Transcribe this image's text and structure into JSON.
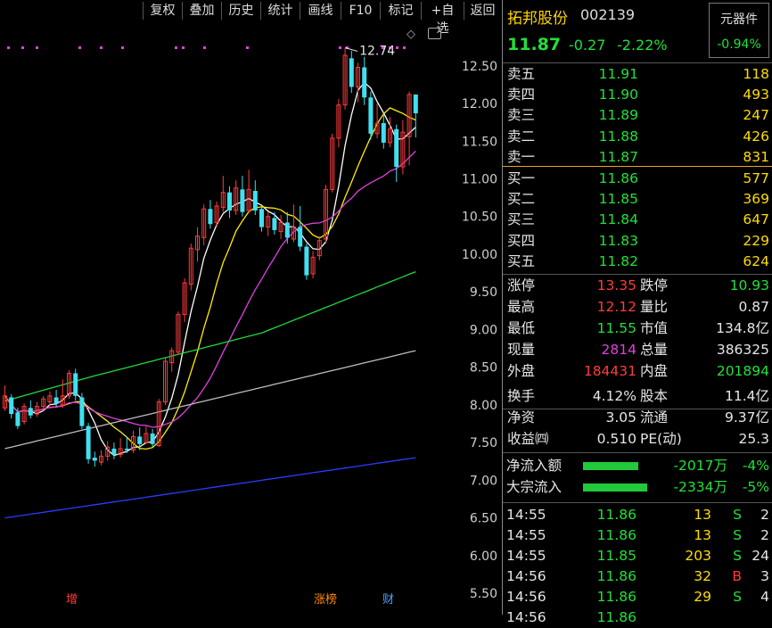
{
  "toolbar": {
    "items": [
      "复权",
      "叠加",
      "历史",
      "统计",
      "画线",
      "F10",
      "标记",
      "+自选",
      "返回"
    ]
  },
  "stock": {
    "name": "拓邦股份",
    "code": "002139",
    "sector": "元器件",
    "sector_change": "-0.94%",
    "price": "11.87",
    "change": "-0.27",
    "change_pct": "-2.22%"
  },
  "orderbook": {
    "asks": [
      {
        "label": "卖五",
        "price": "11.91",
        "vol": "118"
      },
      {
        "label": "卖四",
        "price": "11.90",
        "vol": "493"
      },
      {
        "label": "卖三",
        "price": "11.89",
        "vol": "247"
      },
      {
        "label": "卖二",
        "price": "11.88",
        "vol": "426"
      },
      {
        "label": "卖一",
        "price": "11.87",
        "vol": "831"
      }
    ],
    "bids": [
      {
        "label": "买一",
        "price": "11.86",
        "vol": "577"
      },
      {
        "label": "买二",
        "price": "11.85",
        "vol": "369"
      },
      {
        "label": "买三",
        "price": "11.84",
        "vol": "647"
      },
      {
        "label": "买四",
        "price": "11.83",
        "vol": "229"
      },
      {
        "label": "买五",
        "price": "11.82",
        "vol": "624"
      }
    ]
  },
  "stats": {
    "limit_up_label": "涨停",
    "limit_up": "13.35",
    "limit_down_label": "跌停",
    "limit_down": "10.93",
    "high_label": "最高",
    "high": "12.12",
    "vol_ratio_label": "量比",
    "vol_ratio": "0.87",
    "low_label": "最低",
    "low": "11.55",
    "mktcap_label": "市值",
    "mktcap": "134.8亿",
    "cur_vol_label": "现量",
    "cur_vol": "2814",
    "total_vol_label": "总量",
    "total_vol": "386325",
    "outer_label": "外盘",
    "outer": "184431",
    "inner_label": "内盘",
    "inner": "201894",
    "turnover_label": "换手",
    "turnover": "4.12%",
    "equity_label": "股本",
    "equity": "11.4亿",
    "nav_label": "净资",
    "nav": "3.05",
    "float_label": "流通",
    "float": "9.37亿",
    "eps_label": "收益㈣",
    "eps": "0.510",
    "pe_label": "PE(动)",
    "pe": "25.3"
  },
  "flows": [
    {
      "label": "净流入额",
      "value": "-2017万",
      "pct": "-4%",
      "bar": 0.62
    },
    {
      "label": "大宗流入",
      "value": "-2334万",
      "pct": "-5%",
      "bar": 0.72
    }
  ],
  "ticks": [
    {
      "time": "14:55",
      "price": "11.86",
      "vol": "13",
      "side": "S",
      "n": "2"
    },
    {
      "time": "14:55",
      "price": "11.86",
      "vol": "13",
      "side": "S",
      "n": "2"
    },
    {
      "time": "14:55",
      "price": "11.85",
      "vol": "203",
      "side": "S",
      "n": "24"
    },
    {
      "time": "14:56",
      "price": "11.86",
      "vol": "32",
      "side": "B",
      "n": "3"
    },
    {
      "time": "14:56",
      "price": "11.86",
      "vol": "29",
      "side": "S",
      "n": "4"
    },
    {
      "time": "14:56",
      "price": "11.86",
      "vol": "",
      "side": "",
      "n": ""
    }
  ],
  "chart_data": {
    "type": "candlestick",
    "y_ticks": [
      "12.50",
      "12.00",
      "11.50",
      "11.00",
      "10.50",
      "10.00",
      "9.50",
      "9.00",
      "8.50",
      "8.00",
      "7.50",
      "7.00",
      "6.50",
      "6.00",
      "5.50"
    ],
    "ylim": [
      5.3,
      12.9
    ],
    "high_annotation": "12.74",
    "markers": [
      "增",
      "涨榜",
      "财"
    ],
    "candles": [
      [
        7.96,
        8.12,
        8.26,
        7.92
      ],
      [
        8.1,
        7.88,
        8.14,
        7.82
      ],
      [
        7.9,
        7.72,
        7.96,
        7.68
      ],
      [
        7.78,
        7.98,
        8.02,
        7.74
      ],
      [
        7.96,
        7.86,
        8.06,
        7.82
      ],
      [
        7.88,
        7.98,
        8.04,
        7.84
      ],
      [
        7.98,
        8.08,
        8.12,
        7.92
      ],
      [
        8.04,
        8.12,
        8.18,
        7.98
      ],
      [
        8.1,
        8.02,
        8.2,
        7.98
      ],
      [
        8.0,
        8.12,
        8.34,
        7.96
      ],
      [
        8.12,
        8.42,
        8.46,
        8.08
      ],
      [
        8.42,
        8.12,
        8.48,
        8.06
      ],
      [
        8.1,
        7.72,
        8.16,
        7.68
      ],
      [
        7.72,
        7.28,
        7.76,
        7.22
      ],
      [
        7.3,
        7.26,
        7.38,
        7.18
      ],
      [
        7.24,
        7.32,
        7.4,
        7.2
      ],
      [
        7.32,
        7.44,
        7.52,
        7.26
      ],
      [
        7.42,
        7.34,
        7.5,
        7.28
      ],
      [
        7.34,
        7.42,
        7.56,
        7.3
      ],
      [
        7.42,
        7.4,
        7.58,
        7.36
      ],
      [
        7.4,
        7.58,
        7.66,
        7.36
      ],
      [
        7.58,
        7.48,
        7.7,
        7.4
      ],
      [
        7.5,
        7.62,
        7.72,
        7.48
      ],
      [
        7.62,
        7.48,
        7.68,
        7.44
      ],
      [
        7.46,
        8.04,
        8.08,
        7.44
      ],
      [
        8.04,
        8.58,
        8.62,
        8.0
      ],
      [
        8.56,
        8.72,
        8.76,
        8.44
      ],
      [
        8.7,
        9.2,
        9.24,
        8.66
      ],
      [
        9.2,
        9.62,
        9.68,
        9.1
      ],
      [
        9.6,
        10.08,
        10.14,
        9.52
      ],
      [
        10.06,
        10.24,
        10.36,
        9.9
      ],
      [
        10.22,
        10.6,
        10.66,
        10.12
      ],
      [
        10.6,
        10.4,
        10.72,
        10.34
      ],
      [
        10.42,
        10.64,
        10.7,
        10.36
      ],
      [
        10.62,
        10.82,
        11.04,
        10.56
      ],
      [
        10.82,
        10.58,
        10.9,
        10.48
      ],
      [
        10.58,
        10.88,
        10.98,
        10.52
      ],
      [
        10.86,
        10.56,
        11.04,
        10.5
      ],
      [
        10.58,
        10.86,
        11.12,
        10.54
      ],
      [
        10.84,
        10.58,
        10.98,
        10.52
      ],
      [
        10.6,
        10.36,
        10.64,
        10.3
      ],
      [
        10.36,
        10.5,
        10.56,
        10.24
      ],
      [
        10.48,
        10.32,
        10.56,
        10.26
      ],
      [
        10.3,
        10.42,
        10.52,
        10.2
      ],
      [
        10.42,
        10.22,
        10.56,
        10.14
      ],
      [
        10.2,
        10.36,
        10.66,
        10.16
      ],
      [
        10.36,
        10.1,
        10.64,
        10.04
      ],
      [
        10.1,
        9.72,
        10.14,
        9.66
      ],
      [
        9.74,
        9.96,
        10.04,
        9.68
      ],
      [
        9.98,
        10.18,
        10.24,
        9.92
      ],
      [
        10.2,
        10.86,
        10.92,
        10.14
      ],
      [
        10.86,
        11.54,
        11.6,
        10.82
      ],
      [
        11.54,
        11.98,
        12.06,
        11.42
      ],
      [
        11.98,
        12.64,
        12.74,
        11.92
      ],
      [
        12.6,
        12.22,
        12.7,
        12.14
      ],
      [
        12.22,
        12.48,
        12.54,
        12.02
      ],
      [
        12.48,
        12.08,
        12.62,
        11.98
      ],
      [
        12.08,
        11.6,
        12.16,
        11.52
      ],
      [
        11.6,
        11.74,
        12.0,
        11.54
      ],
      [
        11.74,
        11.48,
        11.86,
        11.4
      ],
      [
        11.48,
        11.66,
        11.82,
        11.42
      ],
      [
        11.66,
        11.16,
        11.72,
        10.96
      ],
      [
        11.16,
        11.62,
        11.78,
        11.06
      ],
      [
        11.56,
        12.12,
        12.16,
        11.18
      ],
      [
        12.12,
        11.87,
        12.12,
        11.55
      ]
    ]
  }
}
